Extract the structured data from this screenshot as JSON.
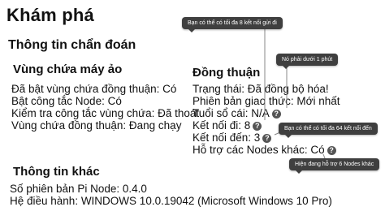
{
  "page_title": "Khám phá",
  "diagnostics_title": "Thông tin chẩn đoán",
  "virtual_zone": {
    "title": "Vùng chứa máy ảo",
    "lines": [
      "Đã bật vùng chứa đồng thuận: Có",
      "Bật công tắc Node: Có",
      "Kiểm tra công tắc vùng chứa: Đã thoát",
      "Vùng chứa đồng thuận: Đang chạy"
    ]
  },
  "consensus": {
    "title": "Đồng thuận",
    "status": "Trạng thái: Đã đồng bộ hóa!",
    "protocol": "Phiên bản giao thức: Mới nhất",
    "ledger_age": "Tuổi sổ cái: N/A",
    "outgoing": "Kết nối đi: 8",
    "incoming": "Kết nối đến: 3",
    "other_nodes": "Hỗ trợ các Nodes khác: Có"
  },
  "tooltips": {
    "outgoing_max": "Bạn có thể có tối đa 8 kết nối gửi đi",
    "ledger_age": "Nó phải dưới 1 phút",
    "incoming_max": "Bạn có thể có tối đa 64 kết nối đến",
    "other_nodes": "Hiện đang hỗ trợ 6 Nodes khác"
  },
  "help_glyph": "?",
  "other_info": {
    "title": "Thông tin khác",
    "lines": [
      "Số phiên bản Pi Node: 0.4.0",
      "Hệ điều hành: WINDOWS 10.0.19042 (Microsoft Windows 10 Pro)"
    ]
  }
}
